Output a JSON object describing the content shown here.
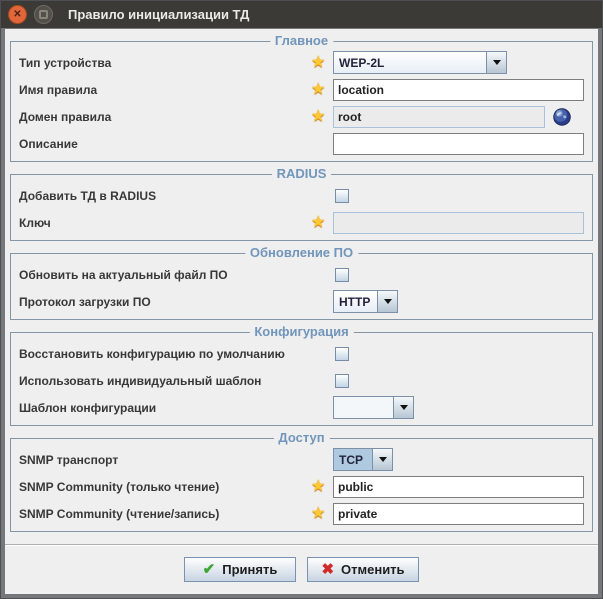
{
  "window": {
    "title": "Правило инициализации ТД"
  },
  "icons": {
    "close": "✕",
    "required_star": "★",
    "accept_check": "✔",
    "cancel_cross": "✖"
  },
  "groups": {
    "main": {
      "title": "Главное",
      "device_type_label": "Тип устройства",
      "device_type_value": "WEP-2L",
      "rule_name_label": "Имя правила",
      "rule_name_value": "location",
      "rule_domain_label": "Домен правила",
      "rule_domain_value": "root",
      "description_label": "Описание",
      "description_value": ""
    },
    "radius": {
      "title": "RADIUS",
      "add_ap_label": "Добавить ТД в RADIUS",
      "add_ap_checked": false,
      "key_label": "Ключ",
      "key_value": ""
    },
    "firmware": {
      "title": "Обновление ПО",
      "update_label": "Обновить на актуальный файл ПО",
      "update_checked": false,
      "protocol_label": "Протокол загрузки ПО",
      "protocol_value": "HTTP"
    },
    "configuration": {
      "title": "Конфигурация",
      "restore_label": "Восстановить конфигурацию по умолчанию",
      "restore_checked": false,
      "use_template_label": "Использовать индивидуальный шаблон",
      "use_template_checked": false,
      "template_label": "Шаблон конфигурации",
      "template_value": ""
    },
    "access": {
      "title": "Доступ",
      "snmp_transport_label": "SNMP транспорт",
      "snmp_transport_value": "TCP",
      "snmp_ro_label": "SNMP Community (только чтение)",
      "snmp_ro_value": "public",
      "snmp_rw_label": "SNMP Community (чтение/запись)",
      "snmp_rw_value": "private"
    }
  },
  "footer": {
    "accept_label": "Принять",
    "cancel_label": "Отменить"
  },
  "colors": {
    "titlebar_bg": "#3C3A36",
    "close_button": "#E2663B",
    "content_bg": "#EFEFEF",
    "group_border": "#8495A6",
    "group_title": "#7195BB",
    "required_star": "#FFC732",
    "selected_combo_bg": "#AFC9E1",
    "accept_icon": "#3FA534",
    "cancel_icon": "#CE2B2B"
  }
}
